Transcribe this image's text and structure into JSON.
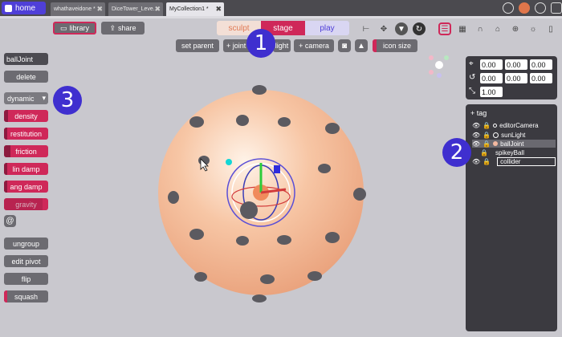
{
  "tabs": {
    "home": "home",
    "items": [
      {
        "label": "whathaveidone *"
      },
      {
        "label": "DiceTower_Leve..."
      },
      {
        "label": "MyCollection1 *"
      }
    ]
  },
  "toolbar": {
    "library": "library",
    "share": "share",
    "modes": [
      "sculpt",
      "stage",
      "play"
    ],
    "set_parent": "set parent",
    "joint": "+ joint",
    "light": "light",
    "camera": "+ camera",
    "icon_size": "icon size"
  },
  "left": {
    "name": "ballJoint",
    "delete": "delete",
    "dynamic": "dynamic",
    "props": [
      "density",
      "restitution",
      "friction",
      "lin damp",
      "ang damp",
      "gravity"
    ],
    "ungroup": "ungroup",
    "edit_pivot": "edit pivot",
    "flip": "flip",
    "squash": "squash"
  },
  "transform": {
    "position": [
      "0.00",
      "0.00",
      "0.00"
    ],
    "rotation": [
      "0.00",
      "0.00",
      "0.00"
    ],
    "scale": "1.00"
  },
  "hierarchy": {
    "tag": "tag",
    "items": [
      "editorCamera",
      "sunLight",
      "ballJoint",
      "spikeyBall",
      "collider"
    ]
  },
  "badges": [
    "1",
    "2",
    "3"
  ],
  "colors": {
    "accent": "#cf2859",
    "brand": "#4f3fd8"
  }
}
